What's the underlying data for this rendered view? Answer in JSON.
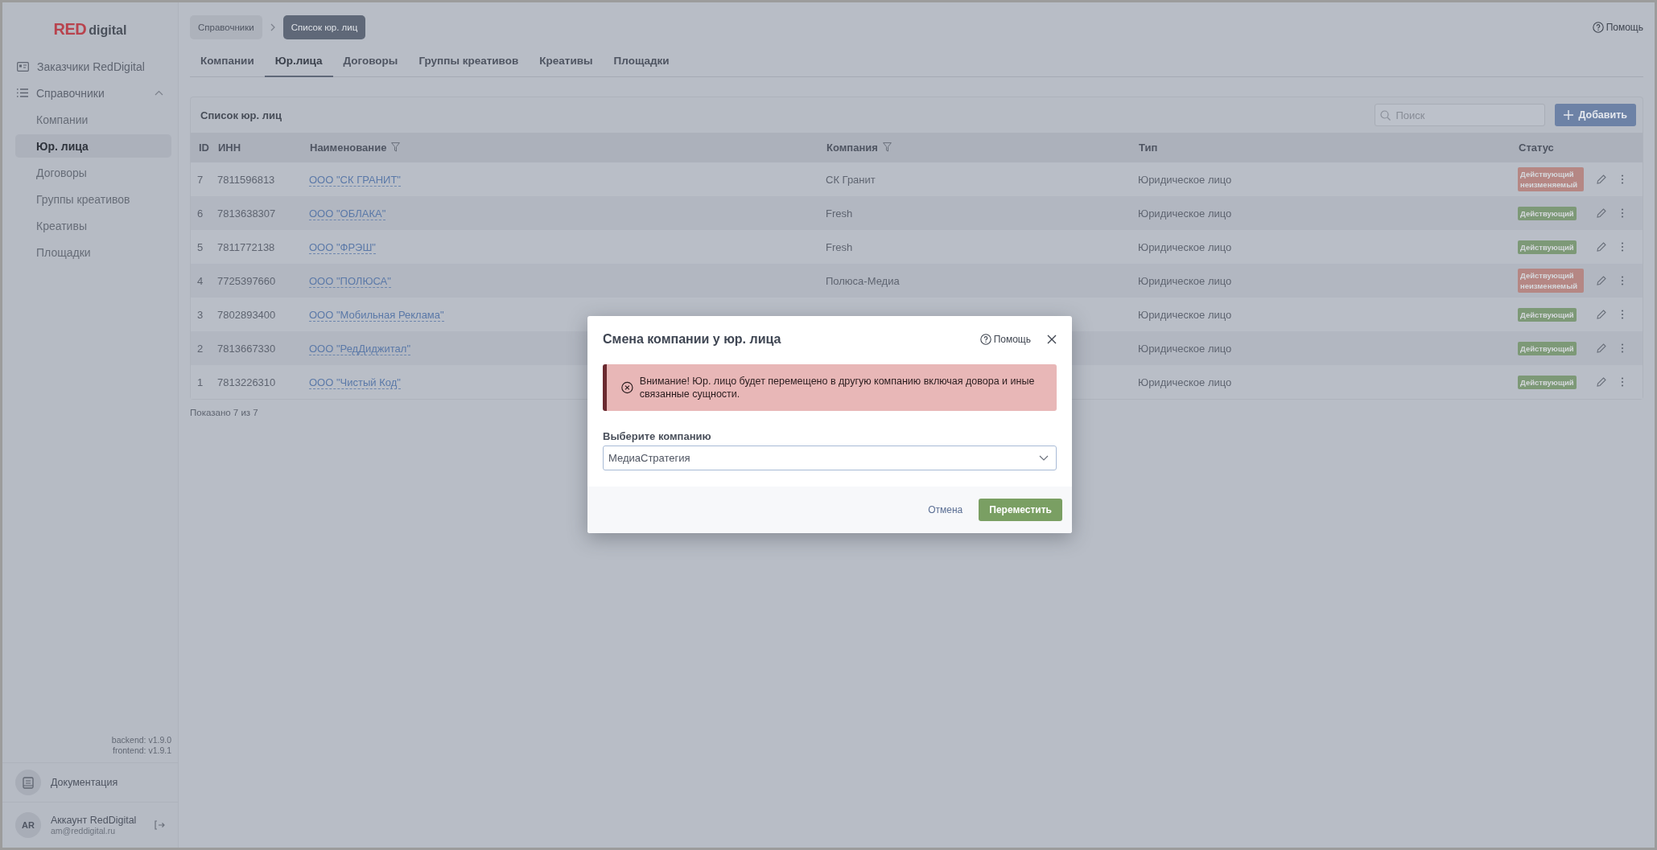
{
  "sidebar": {
    "logo": {
      "brand": "RED",
      "suffix": "digital"
    },
    "items": [
      {
        "label": "Заказчики RedDigital",
        "kind": "link",
        "selected": false
      },
      {
        "label": "Справочники",
        "kind": "group",
        "expanded": true,
        "children": [
          {
            "label": "Компании",
            "selected": false
          },
          {
            "label": "Юр. лица",
            "selected": true
          },
          {
            "label": "Договоры",
            "selected": false
          },
          {
            "label": "Группы креативов",
            "selected": false
          },
          {
            "label": "Креативы",
            "selected": false
          },
          {
            "label": "Площадки",
            "selected": false
          }
        ]
      }
    ],
    "versions": [
      "backend: v1.9.0",
      "frontend: v1.9.1"
    ],
    "documentation": "Документация",
    "account": {
      "initials": "AR",
      "name": "Аккаунт RedDigital",
      "email": "am@reddigital.ru"
    }
  },
  "breadcrumbs": [
    {
      "label": "Справочники",
      "selected": false
    },
    {
      "label": "Список юр. лиц",
      "selected": true
    }
  ],
  "help": "Помощь",
  "tabs": [
    {
      "label": "Компании",
      "selected": false
    },
    {
      "label": "Юр.лица",
      "selected": true
    },
    {
      "label": "Договоры",
      "selected": false
    },
    {
      "label": "Группы креативов",
      "selected": false
    },
    {
      "label": "Креативы",
      "selected": false
    },
    {
      "label": "Площадки",
      "selected": false
    }
  ],
  "card": {
    "title": "Список юр. лиц",
    "search": {
      "placeholder": "Поиск"
    },
    "add_button": "Добавить",
    "columns": [
      {
        "label": "ID",
        "filter": false
      },
      {
        "label": "ИНН",
        "filter": false
      },
      {
        "label": "Наименование",
        "filter": true
      },
      {
        "label": "Компания",
        "filter": true
      },
      {
        "label": "Тип",
        "filter": false
      },
      {
        "label": "Статус",
        "filter": false
      }
    ],
    "rows": [
      {
        "id": "7",
        "inn": "7811596813",
        "name": "ООО \"СК ГРАНИТ\"",
        "company": "СК Гранит",
        "type": "Юридическое лицо",
        "status": {
          "kind": "locked",
          "label": "Действующий неизменяемый"
        }
      },
      {
        "id": "6",
        "inn": "7813638307",
        "name": "ООО \"ОБЛАКА\"",
        "company": "Fresh",
        "type": "Юридическое лицо",
        "status": {
          "kind": "active",
          "label": "Действующий"
        }
      },
      {
        "id": "5",
        "inn": "7811772138",
        "name": "ООО \"ФРЭШ\"",
        "company": "Fresh",
        "type": "Юридическое лицо",
        "status": {
          "kind": "active",
          "label": "Действующий"
        }
      },
      {
        "id": "4",
        "inn": "7725397660",
        "name": "ООО \"ПОЛЮСА\"",
        "company": "Полюса-Медиа",
        "type": "Юридическое лицо",
        "status": {
          "kind": "locked",
          "label": "Действующий неизменяемый"
        }
      },
      {
        "id": "3",
        "inn": "7802893400",
        "name": "ООО \"Мобильная Реклама\"",
        "type": "Юридическое лицо",
        "status": {
          "kind": "active",
          "label": "Действующий"
        }
      },
      {
        "id": "2",
        "inn": "7813667330",
        "name": "ООО \"РедДиджитал\"",
        "type": "Юридическое лицо",
        "status": {
          "kind": "active",
          "label": "Действующий"
        }
      },
      {
        "id": "1",
        "inn": "7813226310",
        "name": "ООО \"Чистый Код\"",
        "type": "Юридическое лицо",
        "status": {
          "kind": "active",
          "label": "Действующий"
        }
      }
    ],
    "footer": "Показано 7 из 7"
  },
  "modal": {
    "title": "Смена компании у юр. лица",
    "help": "Помощь",
    "alert": "Внимание! Юр. лицо будет перемещено в другую компанию включая довора и иные связанные сущности.",
    "field_label": "Выберите компанию",
    "field_value": "МедиаСтратегия",
    "cancel": "Отмена",
    "confirm": "Переместить"
  }
}
